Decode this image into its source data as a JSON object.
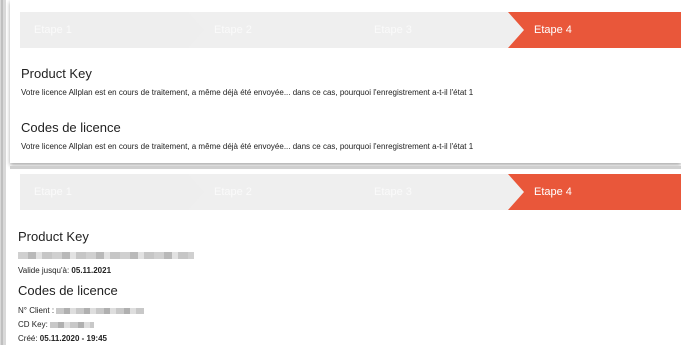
{
  "steps": [
    "Etape 1",
    "Etape 2",
    "Etape 3",
    "Etape 4"
  ],
  "active_step_color": "#e9573a",
  "panel_before": {
    "product_key_title": "Product Key",
    "product_key_text": "Votre licence Allplan est en cours de traitement, a même déjà été envoyée... dans ce cas, pourquoi l'enregistrement a-t-il l'état 1",
    "codes_title": "Codes de licence",
    "codes_text": "Votre licence Allplan est en cours de traitement, a même déjà été envoyée... dans ce cas, pourquoi l'enregistrement a-t-il l'état 1"
  },
  "panel_after": {
    "product_key_title": "Product Key",
    "valid_label": "Valide jusqu'à: ",
    "valid_value": "05.11.2021",
    "codes_title": "Codes de licence",
    "client_label": "N° Client : ",
    "cdkey_label": "CD Key: ",
    "created_label": "Créé: ",
    "created_value": "05.11.2020 - 19:45"
  }
}
